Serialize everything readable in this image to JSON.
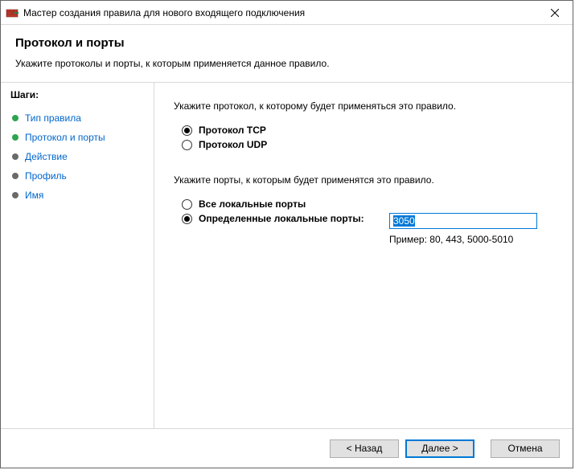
{
  "window": {
    "title": "Мастер создания правила для нового входящего подключения"
  },
  "header": {
    "title": "Протокол и порты",
    "subtitle": "Укажите протоколы и порты, к которым применяется данное правило."
  },
  "sidebar": {
    "label": "Шаги:",
    "steps": [
      {
        "label": "Тип правила",
        "state": "done"
      },
      {
        "label": "Протокол и порты",
        "state": "now"
      },
      {
        "label": "Действие",
        "state": "todo"
      },
      {
        "label": "Профиль",
        "state": "todo"
      },
      {
        "label": "Имя",
        "state": "todo"
      }
    ]
  },
  "main": {
    "protocol_prompt": "Укажите протокол, к которому будет применяться это правило.",
    "protocol_tcp": "Протокол TCP",
    "protocol_udp": "Протокол UDP",
    "protocol_selected": "tcp",
    "ports_prompt": "Укажите порты, к которым будет применятся это правило.",
    "ports_all": "Все локальные порты",
    "ports_specific": "Определенные локальные порты:",
    "ports_selected": "specific",
    "ports_value": "3050",
    "ports_example": "Пример: 80, 443, 5000-5010"
  },
  "buttons": {
    "back": "< Назад",
    "next": "Далее >",
    "cancel": "Отмена"
  }
}
